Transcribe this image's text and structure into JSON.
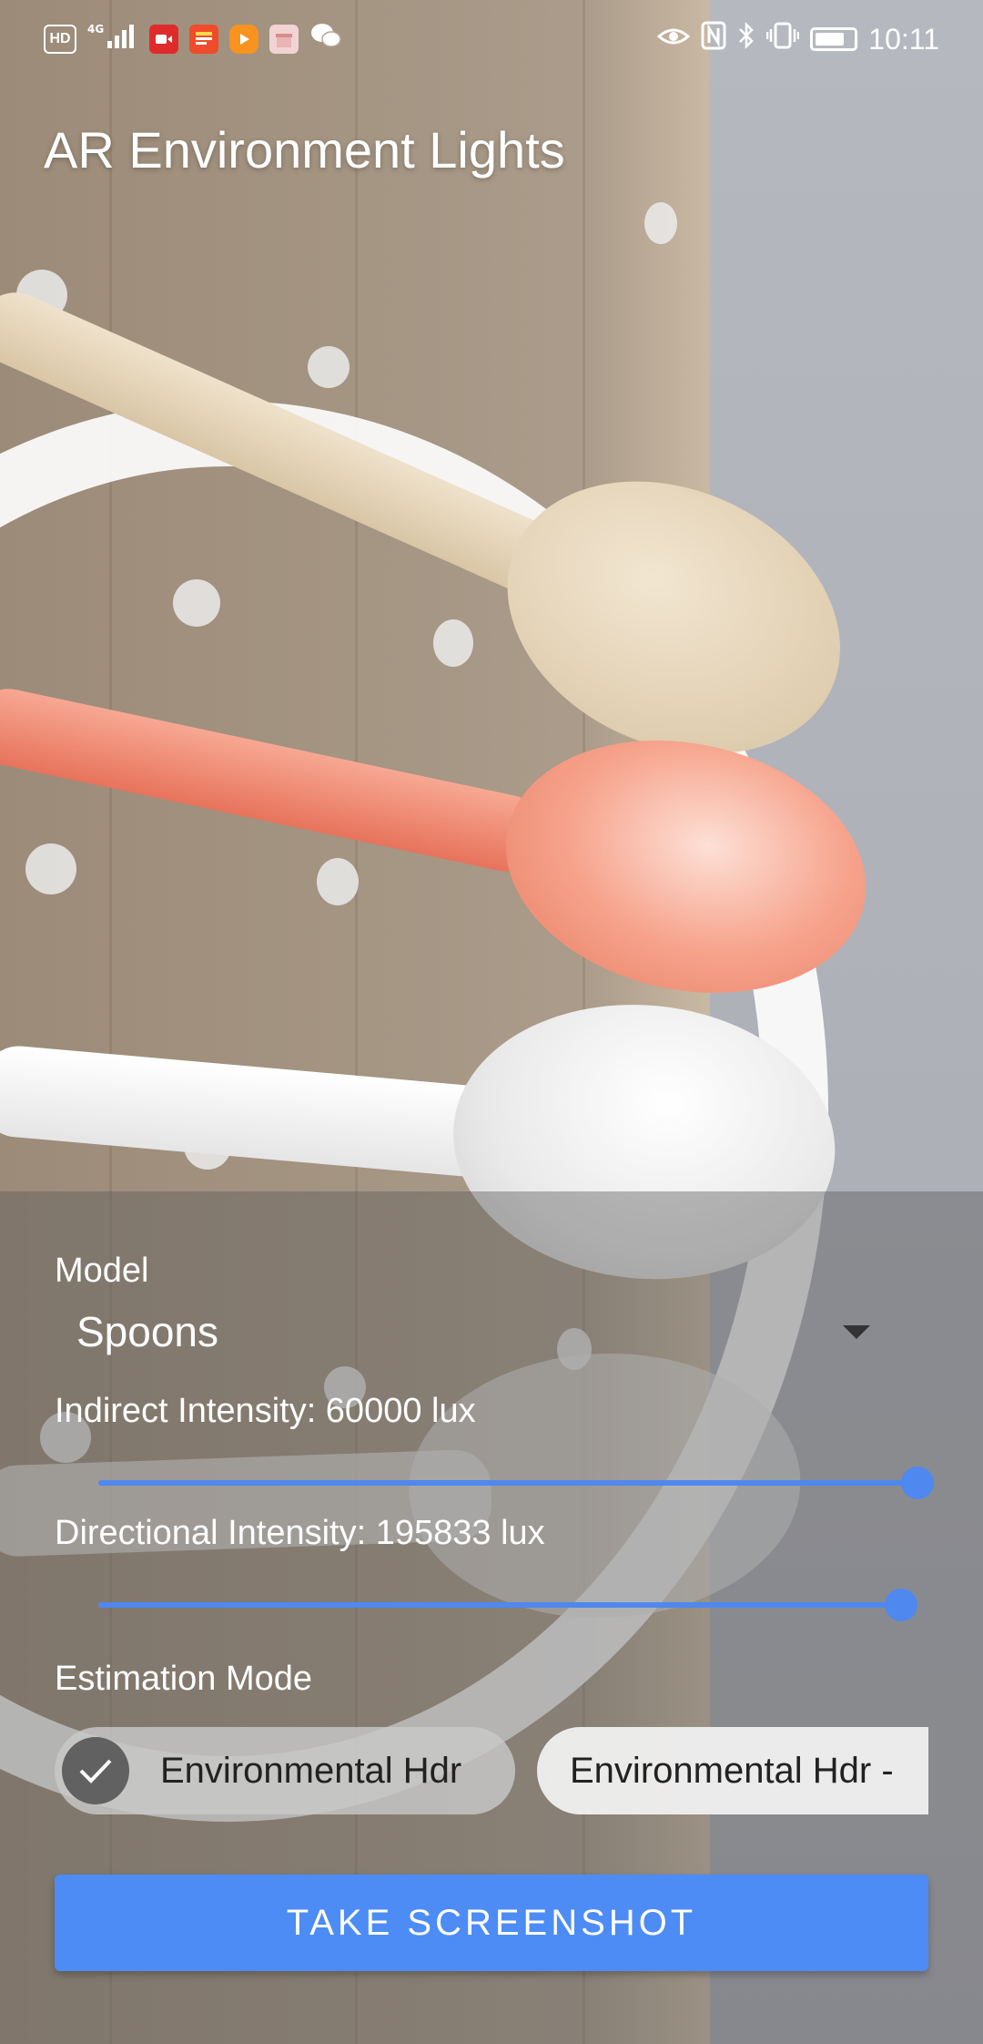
{
  "status_bar": {
    "left_icons": [
      "hd-icon",
      "4g-signal-icon",
      "video-app-icon",
      "news-app-icon",
      "play-app-icon",
      "gift-app-icon",
      "wechat-icon"
    ],
    "right_icons": [
      "eye-comfort-icon",
      "nfc-icon",
      "bluetooth-icon",
      "vibrate-icon",
      "battery-icon"
    ],
    "time": "10:11"
  },
  "app": {
    "title": "AR Environment Lights"
  },
  "controls": {
    "model_label": "Model",
    "model_value": "Spoons",
    "indirect_label": "Indirect Intensity: 60000 lux",
    "indirect_value": 60000,
    "indirect_fraction": 1.0,
    "directional_label": "Directional Intensity: 195833 lux",
    "directional_value": 195833,
    "directional_fraction": 0.98,
    "estimation_label": "Estimation Mode",
    "chips": [
      {
        "label": "Environmental Hdr",
        "selected": true
      },
      {
        "label": "Environmental Hdr -",
        "selected": false
      }
    ],
    "screenshot_button": "TAKE SCREENSHOT"
  },
  "colors": {
    "accent": "#4d8cf5",
    "chip_check": "#616161"
  }
}
